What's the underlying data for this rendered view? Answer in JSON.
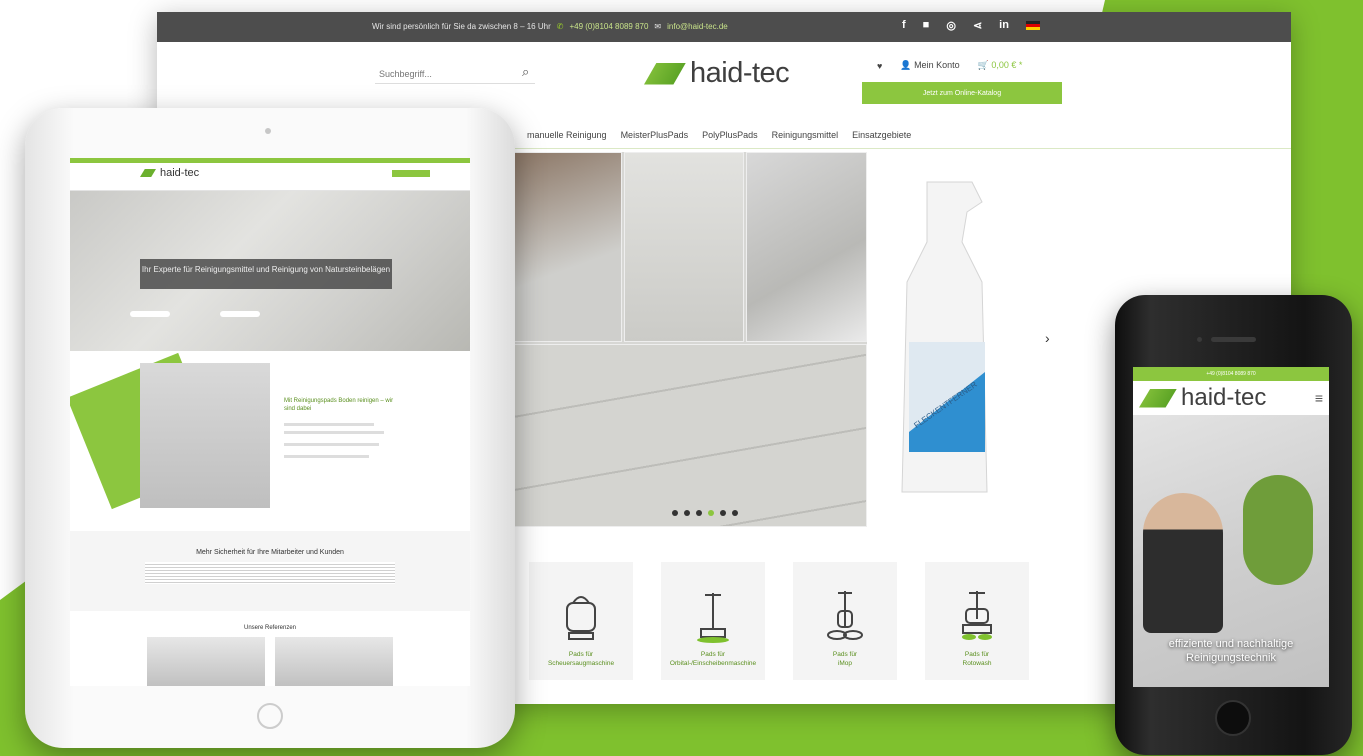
{
  "colors": {
    "brand_green": "#8cc63f",
    "dark_bar": "#4d4d4d",
    "logo_text": "#3f3f3f"
  },
  "desktop": {
    "topbar": {
      "info_text": "Wir sind persönlich für Sie da zwischen 8 – 16 Uhr",
      "phone": "+49 (0)8104 8089 870",
      "email": "info@haid-tec.de",
      "social": [
        "f",
        "■",
        "◎",
        "⋖",
        "in"
      ]
    },
    "search": {
      "placeholder": "Suchbegriff..."
    },
    "logo": {
      "text": "haid-tec"
    },
    "account": {
      "login": "Mein Konto",
      "cart": "0,00 € *"
    },
    "cta": {
      "label": "Jetzt zum Online-Katalog"
    },
    "nav": [
      "manuelle Reinigung",
      "MeisterPlusPads",
      "PolyPlusPads",
      "Reinigungsmittel",
      "Einsatzgebiete"
    ],
    "slider": {
      "bottle_label": "FLECKENTFERNER"
    },
    "categories": [
      {
        "label": "Pads für\nScheuersaugmaschine",
        "icon": "scrubber-icon"
      },
      {
        "label": "Pads für\nOrbital-/Einscheibenmaschine",
        "icon": "single-disc-icon"
      },
      {
        "label": "Pads für\niMop",
        "icon": "imop-icon"
      },
      {
        "label": "Pads für\nRotowash",
        "icon": "rotowash-icon"
      }
    ]
  },
  "tablet": {
    "logo": "haid-tec",
    "hero_caption": "Ihr Experte für Reinigungsmittel und Reinigung von Natursteinbelägen",
    "promo_title": "Mit Reinigungspads Boden reinigen – wir sind dabei",
    "section_heading": "Mehr Sicherheit für Ihre Mitarbeiter und Kunden",
    "references_heading": "Unsere Referenzen"
  },
  "phone": {
    "topbar": "+49 (0)8104 8089 870",
    "logo": "haid-tec",
    "hero_caption": "effiziente und nachhaltige Reinigungstechnik"
  }
}
